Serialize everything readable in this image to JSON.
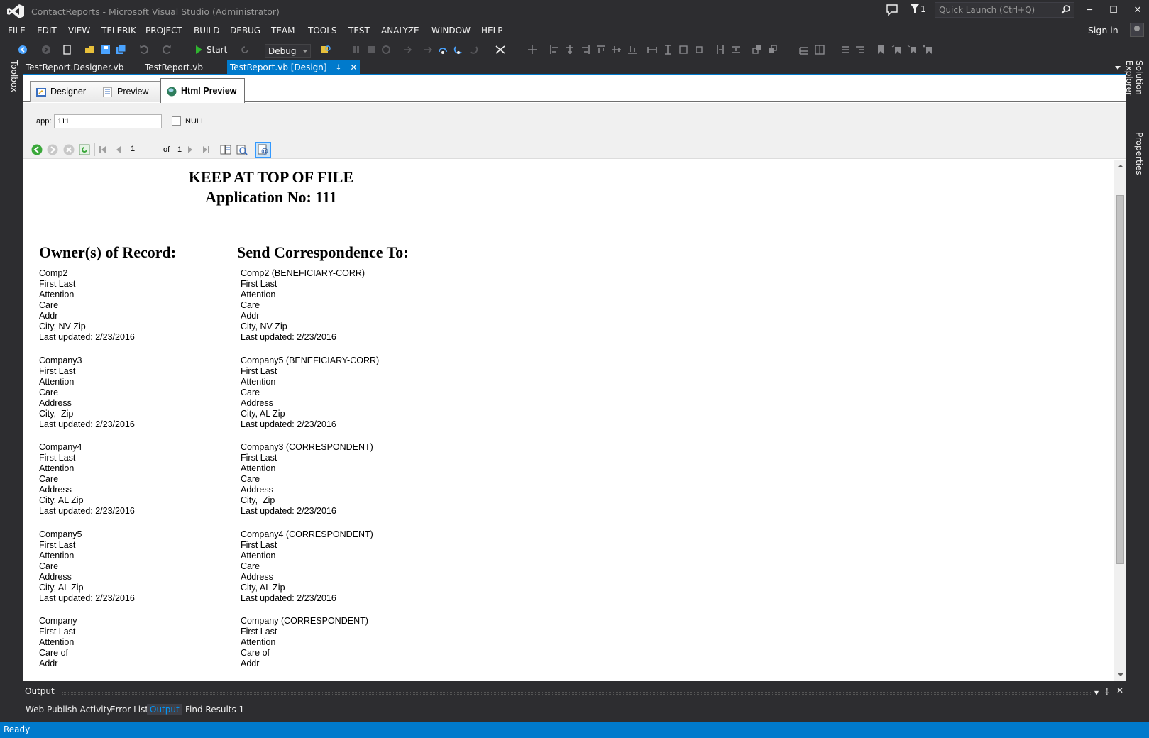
{
  "window": {
    "title": "ContactReports - Microsoft Visual Studio (Administrator)",
    "notification_count": "1",
    "quick_launch_placeholder": "Quick Launch (Ctrl+Q)",
    "minimize": "─",
    "maximize": "☐",
    "close": "✕"
  },
  "menu": {
    "items": [
      "FILE",
      "EDIT",
      "VIEW",
      "TELERIK",
      "PROJECT",
      "BUILD",
      "DEBUG",
      "TEAM",
      "TOOLS",
      "TEST",
      "ANALYZE",
      "WINDOW",
      "HELP"
    ],
    "sign_in": "Sign in"
  },
  "toolbar": {
    "start_label": "Start",
    "configuration": "Debug"
  },
  "side_panels": {
    "left": "Toolbox",
    "right_top": "Solution Explorer",
    "right_bottom": "Properties"
  },
  "doc_tabs": [
    {
      "label": "TestReport.Designer.vb",
      "active": false
    },
    {
      "label": "TestReport.vb",
      "active": false
    },
    {
      "label": "TestReport.vb [Design]",
      "active": true
    }
  ],
  "view_tabs": [
    {
      "label": "Designer",
      "active": false
    },
    {
      "label": "Preview",
      "active": false
    },
    {
      "label": "Html Preview",
      "active": true
    }
  ],
  "parameters": {
    "app_label": "app:",
    "app_value": "111",
    "null_label": "NULL",
    "null_checked": false
  },
  "report_toolbar": {
    "page": "1",
    "of_label": "of",
    "total_pages": "1"
  },
  "report": {
    "title_line1": "KEEP AT TOP OF FILE",
    "title_line2": "Application No: 111",
    "owners_heading": "Owner(s) of Record:",
    "correspondence_heading": "Send Correspondence To:",
    "owners": [
      [
        "Comp2",
        "First Last",
        "Attention",
        "Care",
        "Addr",
        "City, NV Zip",
        "Last updated: 2/23/2016"
      ],
      [
        "Company3",
        "First Last",
        "Attention",
        "Care",
        "Address",
        "City,  Zip",
        "Last updated: 2/23/2016"
      ],
      [
        "Company4",
        "First Last",
        "Attention",
        "Care",
        "Address",
        "City, AL Zip",
        "Last updated: 2/23/2016"
      ],
      [
        "Company5",
        "First Last",
        "Attention",
        "Care",
        "Address",
        "City, AL Zip",
        "Last updated: 2/23/2016"
      ],
      [
        "Company",
        "First Last",
        "Attention",
        "Care of",
        "Addr"
      ]
    ],
    "correspondence": [
      [
        "Comp2 (BENEFICIARY-CORR)",
        "First Last",
        "Attention",
        "Care",
        "Addr",
        "City, NV Zip",
        "Last updated: 2/23/2016"
      ],
      [
        "Company5 (BENEFICIARY-CORR)",
        "First Last",
        "Attention",
        "Care",
        "Address",
        "City, AL Zip",
        "Last updated: 2/23/2016"
      ],
      [
        "Company3 (CORRESPONDENT)",
        "First Last",
        "Attention",
        "Care",
        "Address",
        "City,  Zip",
        "Last updated: 2/23/2016"
      ],
      [
        "Company4 (CORRESPONDENT)",
        "First Last",
        "Attention",
        "Care",
        "Address",
        "City, AL Zip",
        "Last updated: 2/23/2016"
      ],
      [
        "Company (CORRESPONDENT)",
        "First Last",
        "Attention",
        "Care of",
        "Addr"
      ]
    ]
  },
  "output_panel": {
    "title": "Output",
    "tabs": [
      {
        "label": "Web Publish Activity",
        "active": false
      },
      {
        "label": "Error List",
        "active": false
      },
      {
        "label": "Output",
        "active": true
      },
      {
        "label": "Find Results 1",
        "active": false
      }
    ]
  },
  "status": {
    "text": "Ready"
  },
  "colors": {
    "accent": "#007acc",
    "chrome_bg": "#2d2d30",
    "play_green": "#2fb52f"
  }
}
